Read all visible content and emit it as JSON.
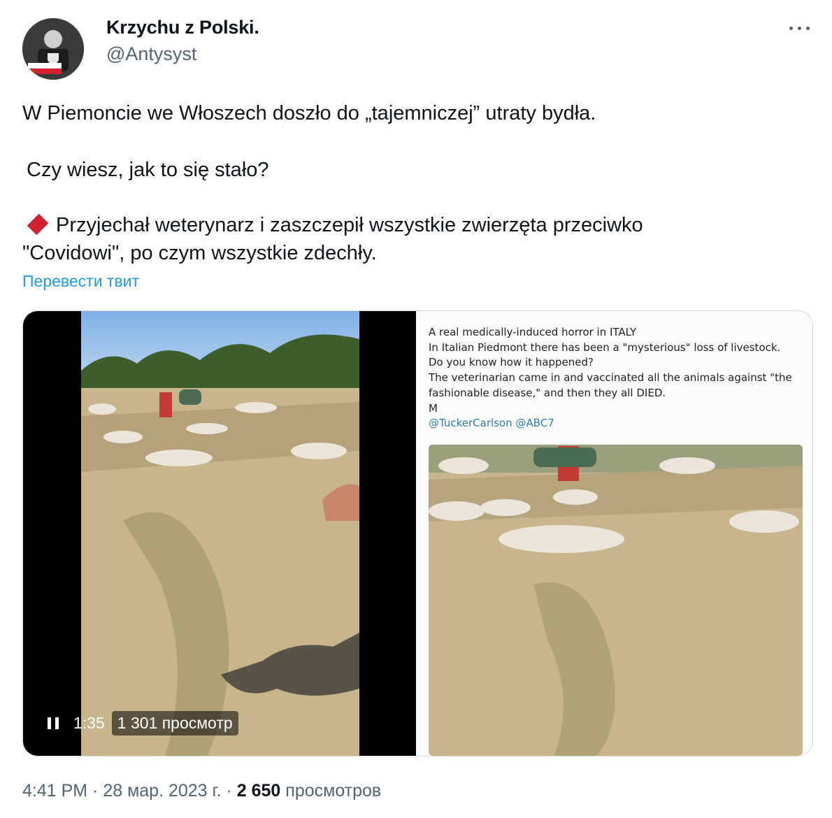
{
  "author": {
    "display_name": "Krzychu z Polski.",
    "handle": "@Antysyst"
  },
  "tweet": {
    "lines": [
      "W Piemoncie we Włoszech doszło do „tajemniczej” utraty bydła.",
      "Czy wiesz, jak to się stało?",
      "Przyjechał weterynarz i zaszczepił wszystkie zwierzęta przeciwko",
      "\"Covidowi\", po czym wszystkie zdechły."
    ],
    "translate_label": "Перевести твит"
  },
  "video": {
    "time": "1:35",
    "views": "1 301 просмотр"
  },
  "quoted_image": {
    "text_lines": [
      "A real medically-induced horror in ITALY",
      "In Italian Piedmont there has been a \"mysterious\" loss of livestock.",
      "Do you know how it happened?",
      "The veterinarian came in and vaccinated all the animals against \"the",
      "fashionable disease,\" and then they all DIED.",
      "M"
    ],
    "mentions": "@TuckerCarlson @ABC7"
  },
  "footer": {
    "time": "4:41 PM",
    "date": "28 мар. 2023 г.",
    "views_count": "2 650",
    "views_label": "просмотров"
  },
  "colors": {
    "accent": "#1d9bf0",
    "secondary_text": "#536471",
    "diamond": "#d1202f"
  }
}
